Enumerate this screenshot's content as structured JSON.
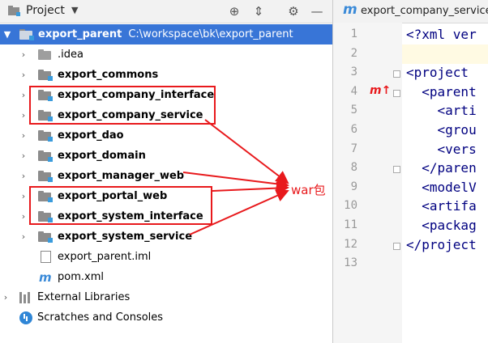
{
  "panel": {
    "title": "Project",
    "caret": "▼"
  },
  "tree": {
    "root": {
      "name": "export_parent",
      "path": "C:\\workspace\\bk\\export_parent"
    },
    "items": [
      {
        "name": ".idea",
        "bold": false
      },
      {
        "name": "export_commons",
        "bold": true
      },
      {
        "name": "export_company_interface",
        "bold": true
      },
      {
        "name": "export_company_service",
        "bold": true
      },
      {
        "name": "export_dao",
        "bold": true
      },
      {
        "name": "export_domain",
        "bold": true
      },
      {
        "name": "export_manager_web",
        "bold": true
      },
      {
        "name": "export_portal_web",
        "bold": true
      },
      {
        "name": "export_system_interface",
        "bold": true
      },
      {
        "name": "export_system_service",
        "bold": true
      }
    ],
    "files": [
      {
        "name": "export_parent.iml"
      },
      {
        "name": "pom.xml"
      }
    ],
    "external_libraries": "External Libraries",
    "scratches": "Scratches and Consoles"
  },
  "annotation": {
    "label": "war包",
    "color": "#e8191c"
  },
  "editor": {
    "tab_title": "export_company_service",
    "line_numbers": [
      "1",
      "2",
      "3",
      "4",
      "5",
      "6",
      "7",
      "8",
      "9",
      "10",
      "11",
      "12",
      "13"
    ],
    "lines": [
      "<?xml ver",
      "",
      "<project ",
      "  <parent",
      "    <arti",
      "    <grou",
      "    <vers",
      "  </paren",
      "  <modelV",
      "  <artifa",
      "  <packag",
      "</project",
      ""
    ]
  },
  "colors": {
    "selection": "#3875d7",
    "module_badge": "#3a9bdc",
    "annotation_red": "#e8191c"
  }
}
